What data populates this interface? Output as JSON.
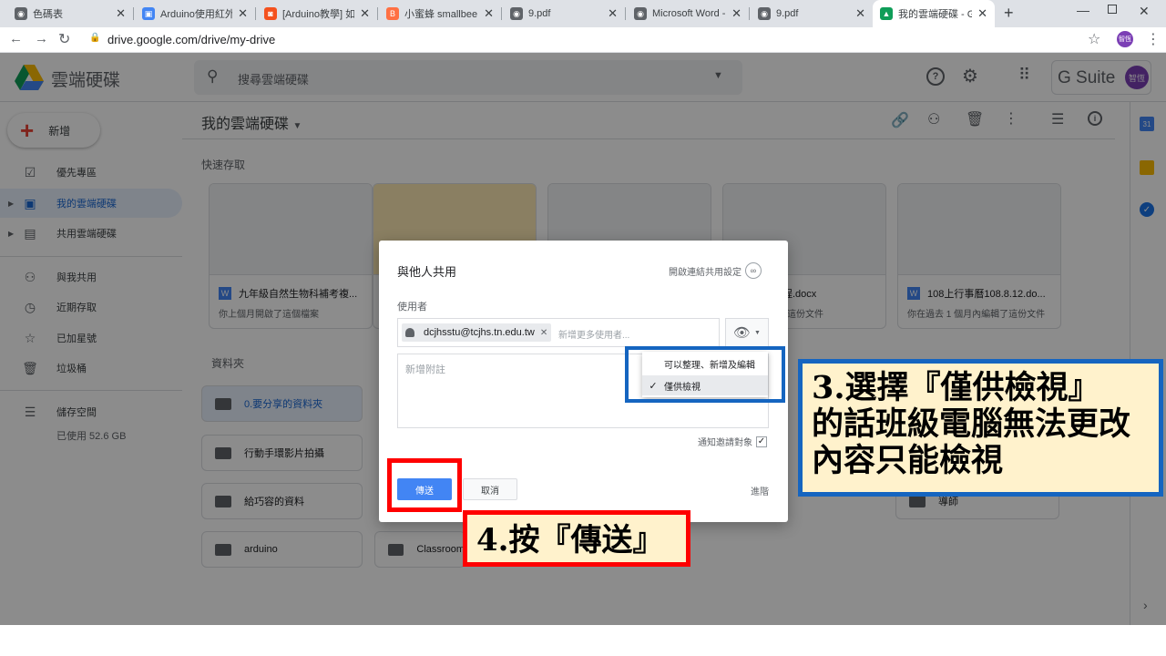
{
  "browser": {
    "tabs": [
      {
        "title": "色碼表",
        "fav_color": "#5f6368",
        "fav_glyph": "◉"
      },
      {
        "title": "Arduino使用紅外線",
        "fav_color": "#4285f4",
        "fav_glyph": "▣"
      },
      {
        "title": "[Arduino教學] 如何",
        "fav_color": "#f4511e",
        "fav_glyph": "◙"
      },
      {
        "title": "小蜜蜂 smallbee",
        "fav_color": "#ff7043",
        "fav_glyph": "B"
      },
      {
        "title": "9.pdf",
        "fav_color": "#5f6368",
        "fav_glyph": "◉"
      },
      {
        "title": "Microsoft Word -",
        "fav_color": "#5f6368",
        "fav_glyph": "◉"
      },
      {
        "title": "9.pdf",
        "fav_color": "#5f6368",
        "fav_glyph": "◉"
      },
      {
        "title": "我的雲端硬碟 - Go",
        "fav_color": "#0f9d58",
        "fav_glyph": "▲"
      }
    ],
    "url": "drive.google.com/drive/my-drive",
    "profile_label": "智恆"
  },
  "drive": {
    "app_name": "雲端硬碟",
    "search_placeholder": "搜尋雲端硬碟",
    "gsuite_label": "G Suite",
    "avatar_label": "智恆",
    "new_button": "新增",
    "sidebar": [
      {
        "label": "優先專區",
        "icon": "☑"
      },
      {
        "label": "我的雲端硬碟",
        "icon": "▣"
      },
      {
        "label": "共用雲端硬碟",
        "icon": "▤"
      },
      {
        "label": "與我共用",
        "icon": "⚇"
      },
      {
        "label": "近期存取",
        "icon": "◷"
      },
      {
        "label": "已加星號",
        "icon": "☆"
      },
      {
        "label": "垃圾桶",
        "icon": "🗑"
      },
      {
        "label": "儲存空間",
        "icon": "☰"
      }
    ],
    "storage_used": "已使用 52.6 GB",
    "page_title": "我的雲端硬碟",
    "quick_access_label": "快速存取",
    "quick_access": [
      {
        "name": "九年級自然生物科補考複...",
        "subtitle": "你上個月開啟了這個檔案"
      },
      {
        "name": "",
        "subtitle": ""
      },
      {
        "name": "",
        "subtitle": ""
      },
      {
        "name": "進修流程.docx",
        "subtitle": "你昨天編輯過這份文件"
      },
      {
        "name": "108上行事曆108.8.12.do...",
        "subtitle": "你在過去 1 個月內編輯了這份文件"
      }
    ],
    "folders_label": "資料夾",
    "folders": [
      {
        "name": "0.要分享的資料夾"
      },
      {
        "name": "行動手環影片拍攝"
      },
      {
        "name": "給巧容的資料"
      },
      {
        "name": "arduino"
      },
      {
        "name": "Classroom"
      },
      {
        "name": "導師"
      }
    ]
  },
  "dialog": {
    "title": "與他人共用",
    "link_share": "開啟連結共用設定",
    "people_label": "使用者",
    "chip_email": "dcjhsstu@tcjhs.tn.edu.tw",
    "add_more_placeholder": "新增更多使用者...",
    "note_placeholder": "新增附註",
    "notify_label": "通知邀請對象",
    "send_button": "傳送",
    "cancel_button": "取消",
    "advanced": "進階",
    "permission_options": [
      {
        "label": "可以整理、新增及編輯",
        "selected": false
      },
      {
        "label": "僅供檢視",
        "selected": true
      }
    ]
  },
  "annotations": {
    "step3": [
      "3.選擇『僅供檢視』",
      "的話班級電腦無法更改",
      "內容只能檢視"
    ],
    "step4": "4.按『傳送』"
  },
  "colors": {
    "accent_blue": "#4285f4",
    "highlight_red": "#ff0000",
    "highlight_blue": "#1565c0",
    "callout_bg": "#fff2cc"
  }
}
